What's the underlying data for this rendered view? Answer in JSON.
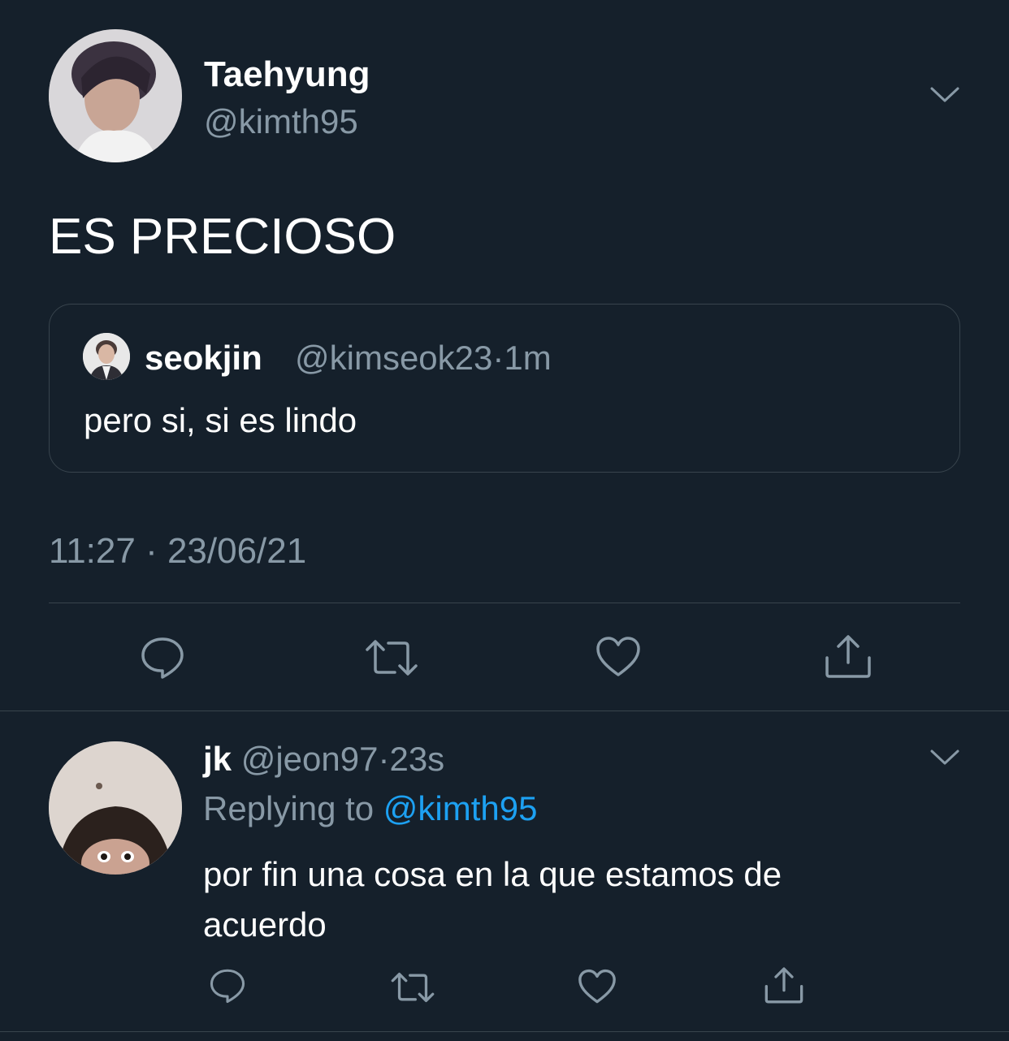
{
  "main_tweet": {
    "display_name": "Taehyung",
    "handle": "@kimth95",
    "text": "ES PRECIOSO",
    "timestamp": "11:27 · 23/06/21",
    "quoted": {
      "display_name": "seokjin",
      "handle": "@kimseok23",
      "separator": "·",
      "time": "1m",
      "text": "pero si, si es lindo"
    },
    "actions": [
      "reply-icon",
      "retweet-icon",
      "like-icon",
      "share-icon"
    ]
  },
  "reply_tweet": {
    "display_name": "jk",
    "handle": "@jeon97",
    "separator": "·",
    "time": "23s",
    "replying_prefix": "Replying to",
    "replying_handle": "@kimth95",
    "text_line1": "por fin una cosa en la que estamos de",
    "text_line2": "acuerdo",
    "actions": [
      "reply-icon",
      "retweet-icon",
      "like-icon",
      "share-icon"
    ]
  },
  "colors": {
    "background": "#15202b",
    "muted": "#8899a6",
    "link": "#1da1f2",
    "divider": "#38444d"
  }
}
